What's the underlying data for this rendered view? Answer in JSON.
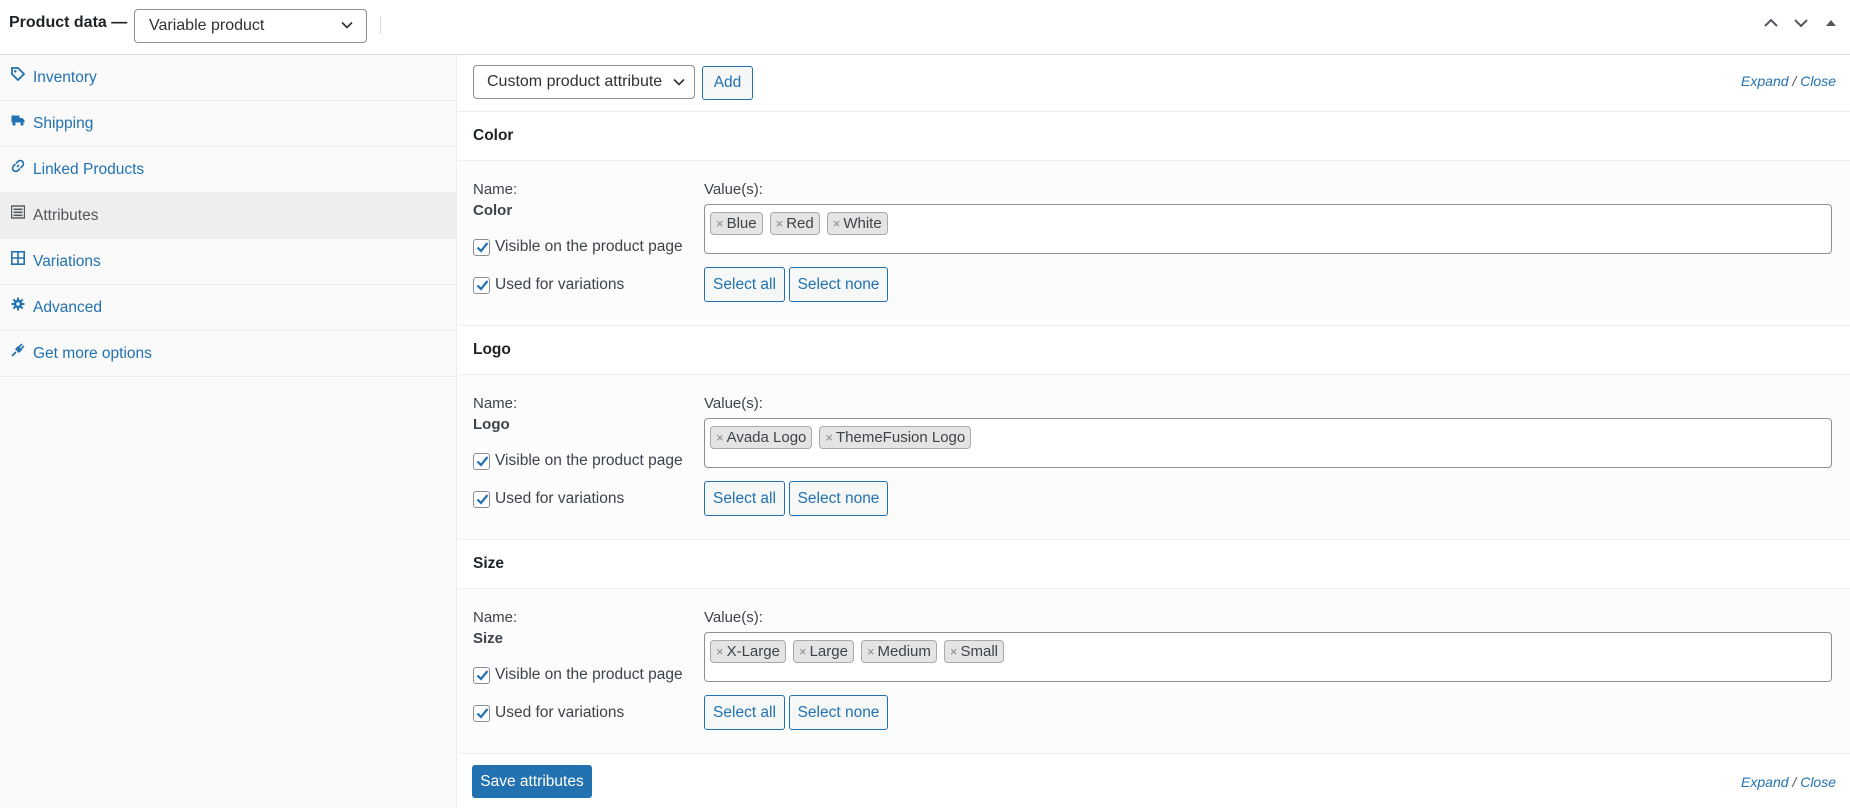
{
  "header": {
    "title": "Product data —",
    "product_type": "Variable product"
  },
  "sidebar": {
    "items": [
      {
        "label": "Inventory",
        "icon": "tag-icon"
      },
      {
        "label": "Shipping",
        "icon": "truck-icon"
      },
      {
        "label": "Linked Products",
        "icon": "link-icon"
      },
      {
        "label": "Attributes",
        "icon": "list-icon",
        "active": true
      },
      {
        "label": "Variations",
        "icon": "grid-icon"
      },
      {
        "label": "Advanced",
        "icon": "gear-icon"
      },
      {
        "label": "Get more options",
        "icon": "plugin-icon"
      }
    ]
  },
  "toolbar": {
    "attribute_select": "Custom product attribute",
    "add_label": "Add",
    "expand": "Expand",
    "slash": " / ",
    "close": "Close"
  },
  "labels": {
    "name": "Name:",
    "values": "Value(s):",
    "visible": "Visible on the product page",
    "used": "Used for variations",
    "select_all": "Select all",
    "select_none": "Select none"
  },
  "attributes": [
    {
      "name": "Color",
      "values": [
        "Blue",
        "Red",
        "White"
      ],
      "visible": true,
      "used_for_variations": true
    },
    {
      "name": "Logo",
      "values": [
        "Avada Logo",
        "ThemeFusion Logo"
      ],
      "visible": true,
      "used_for_variations": true
    },
    {
      "name": "Size",
      "values": [
        "X-Large",
        "Large",
        "Medium",
        "Small"
      ],
      "visible": true,
      "used_for_variations": true
    }
  ],
  "footer": {
    "save_label": "Save attributes"
  },
  "colors": {
    "accent": "#2271b1",
    "text": "#3c434a"
  },
  "tag_remove_glyph": "×"
}
